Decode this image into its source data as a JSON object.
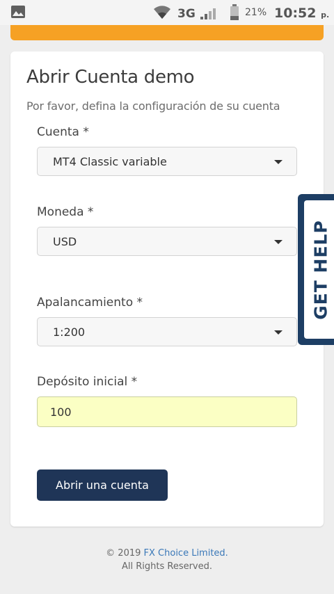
{
  "status_bar": {
    "network": "3G",
    "battery_percent": "21%",
    "time": "10:52",
    "ampm": "p. m.",
    "icons": [
      "gallery-icon",
      "wifi-icon",
      "signal-icon",
      "battery-icon"
    ]
  },
  "form": {
    "title": "Abrir Cuenta demo",
    "subtitle": "Por favor, defina la configuración de su cuenta",
    "account_label": "Cuenta *",
    "account_value": "MT4 Classic variable",
    "currency_label": "Moneda *",
    "currency_value": "USD",
    "leverage_label": "Apalancamiento *",
    "leverage_value": "1:200",
    "deposit_label": "Depósito inicial *",
    "deposit_value": "100",
    "submit_label": "Abrir una cuenta"
  },
  "help_tab": {
    "label": "GET HELP"
  },
  "footer": {
    "copyright_prefix": "© 2019 ",
    "company": "FX Choice Limited.",
    "rights": "All Rights Reserved."
  },
  "colors": {
    "accent_orange": "#f6a124",
    "button_navy": "#1f3557",
    "help_navy": "#1d3e64",
    "input_highlight": "#fbffc4",
    "link_blue": "#3a78b8"
  }
}
